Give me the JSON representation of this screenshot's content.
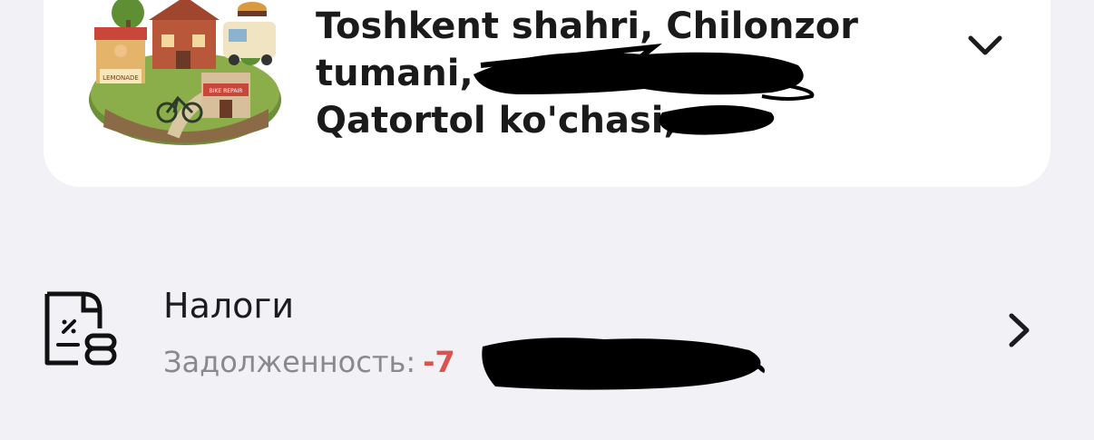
{
  "address": {
    "line1": "Toshkent shahri, Chilonzor",
    "line2": "tumani,",
    "line3": "Qatortol ko'chasi,"
  },
  "illustration": {
    "sign_lemonade": "LEMONADE",
    "sign_bike_repair": "BIKE REPAIR"
  },
  "tax": {
    "title": "Налоги",
    "debt_label": "Задолженность:",
    "debt_value": "-7"
  },
  "icons": {
    "expand": "chevron-down-icon",
    "tax": "tax-document-icon",
    "open": "chevron-right-icon"
  },
  "colors": {
    "background": "#f2f1f6",
    "card": "#ffffff",
    "debt": "#d9534f",
    "secondary_text": "#8a8a8e"
  }
}
